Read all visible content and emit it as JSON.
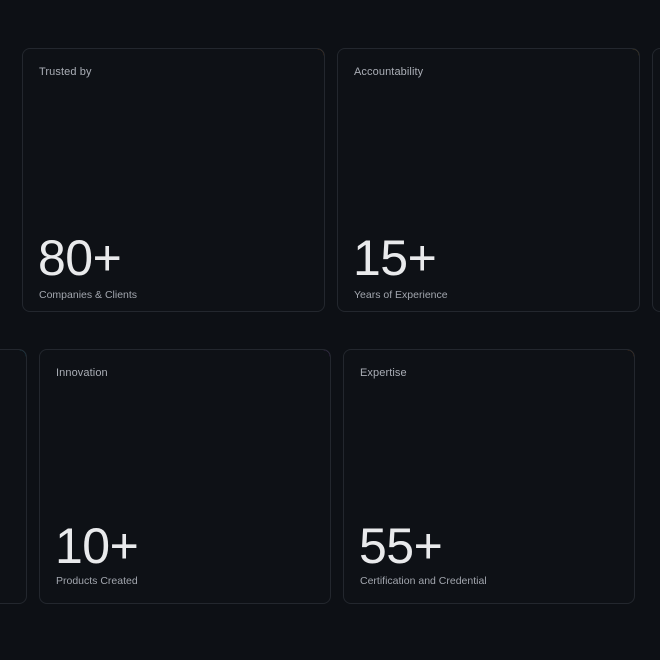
{
  "cards": [
    {
      "label": "Trusted by",
      "value": "80+",
      "caption": "Companies & Clients",
      "accent": "#f08a2c"
    },
    {
      "label": "Accountability",
      "value": "15+",
      "caption": "Years of Experience",
      "accent": "#f2b63a"
    },
    {
      "label": "",
      "value": "",
      "caption": "",
      "accent": "#3b4048"
    },
    {
      "label": "",
      "value": "",
      "caption": "",
      "accent": "#27b6d8"
    },
    {
      "label": "Innovation",
      "value": "10+",
      "caption": "Products Created",
      "accent": "#b45de6"
    },
    {
      "label": "Expertise",
      "value": "55+",
      "caption": "Certification and Credential",
      "accent": "#f08a2c"
    }
  ]
}
